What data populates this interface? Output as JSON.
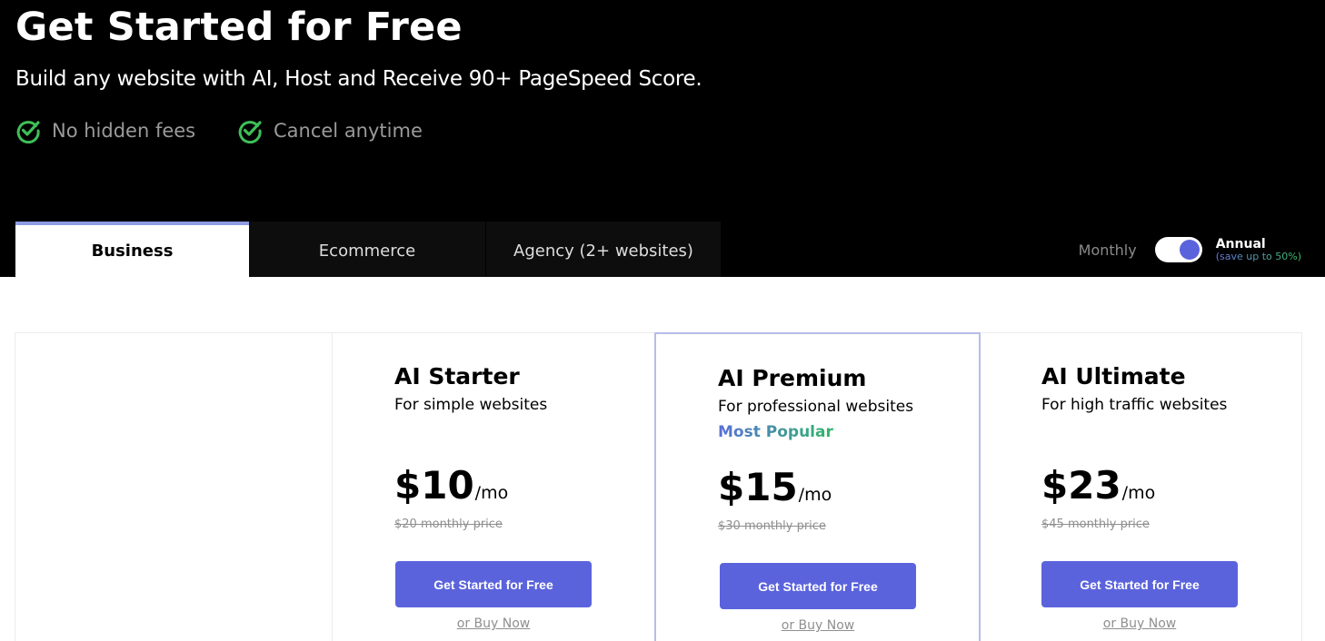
{
  "hero": {
    "title": "Get Started for Free",
    "subtitle": "Build any website with AI, Host and Receive 90+ PageSpeed Score.",
    "features": [
      "No hidden fees",
      "Cancel anytime"
    ],
    "feature_icon": "check-circle-icon",
    "feature_icon_color": "#3fbf57"
  },
  "tabs": [
    "Business",
    "Ecommerce",
    "Agency (2+ websites)"
  ],
  "active_tab": "Business",
  "billing": {
    "monthly_label": "Monthly",
    "annual_label": "Annual",
    "annual_note": "(save up to 50%)",
    "selected": "Annual"
  },
  "plans": [
    {
      "name": "AI Starter",
      "description": "For simple websites",
      "badge": "",
      "price": "$10",
      "period": "/mo",
      "old_price": "$20 monthly price",
      "cta": "Get Started for Free",
      "buy": "or Buy Now"
    },
    {
      "name": "AI Premium",
      "description": "For professional websites",
      "badge": "Most Popular",
      "price": "$15",
      "period": "/mo",
      "old_price": "$30 monthly price",
      "cta": "Get Started for Free",
      "buy": "or Buy Now"
    },
    {
      "name": "AI Ultimate",
      "description": "For high traffic websites",
      "badge": "",
      "price": "$23",
      "period": "/mo",
      "old_price": "$45 monthly price",
      "cta": "Get Started for Free",
      "buy": "or Buy Now"
    }
  ],
  "colors": {
    "accent": "#5b63dc",
    "hero_bg": "#000000",
    "highlight_border": "#b6bce8"
  }
}
